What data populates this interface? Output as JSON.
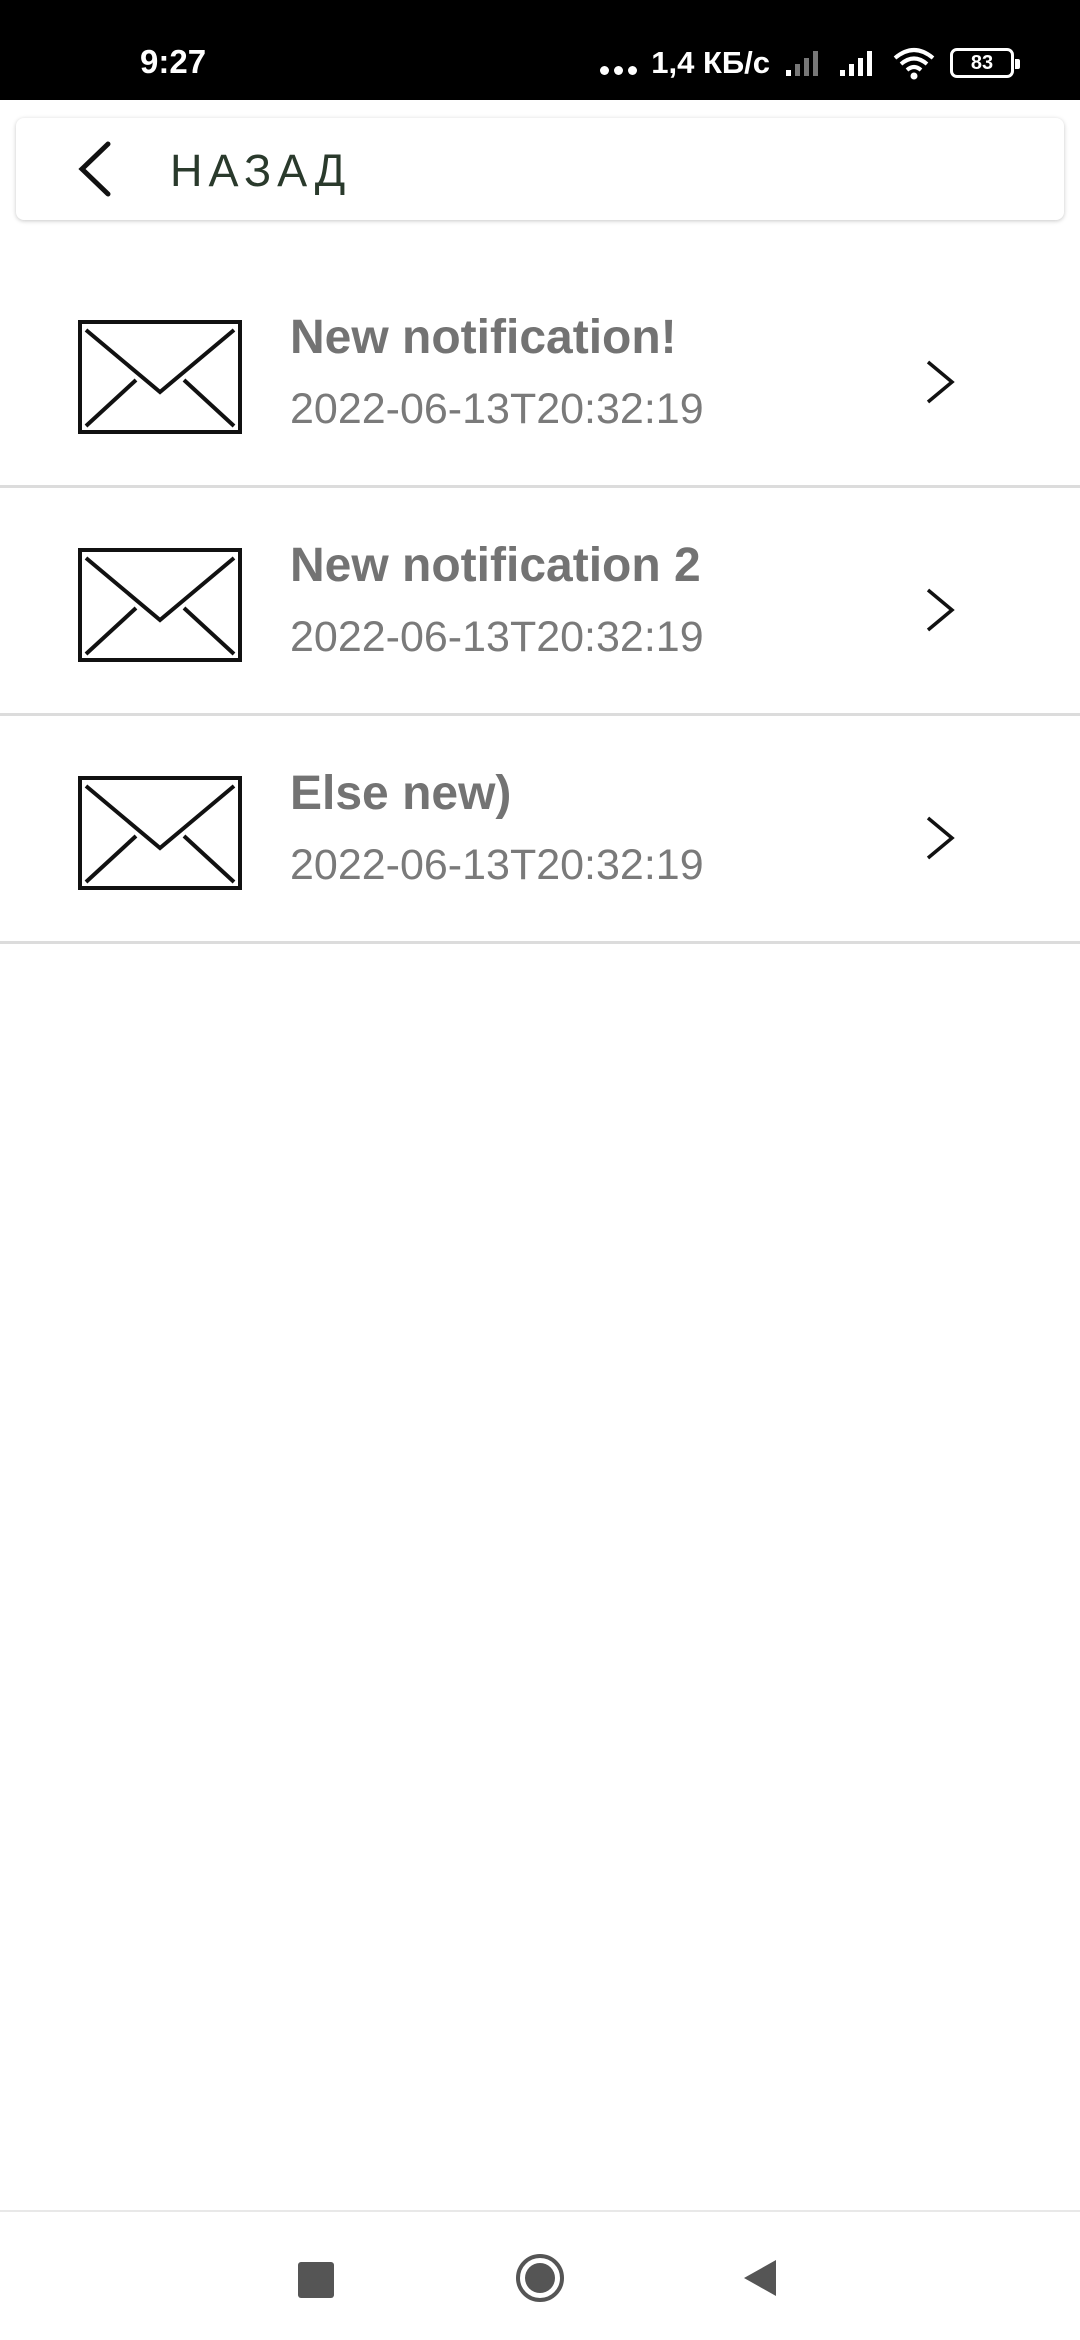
{
  "status_bar": {
    "time": "9:27",
    "network_speed": "1,4 КБ/с",
    "battery": "83"
  },
  "header": {
    "back_label": "НАЗАД"
  },
  "notifications": [
    {
      "title": "New notification!",
      "date": "2022-06-13T20:32:19"
    },
    {
      "title": "New notification 2",
      "date": "2022-06-13T20:32:19"
    },
    {
      "title": "Else new)",
      "date": "2022-06-13T20:32:19"
    }
  ],
  "icons": {
    "back": "chevron-left-icon",
    "item": "envelope-icon",
    "item_action": "chevron-right-icon",
    "nav": [
      "recents-square-icon",
      "home-circle-icon",
      "back-triangle-icon"
    ]
  },
  "colors": {
    "status_bar": "#000000",
    "back_label": "#2a3a2c",
    "title": "#737373",
    "date": "#7a7a7a",
    "divider": "#dcdcdc"
  }
}
